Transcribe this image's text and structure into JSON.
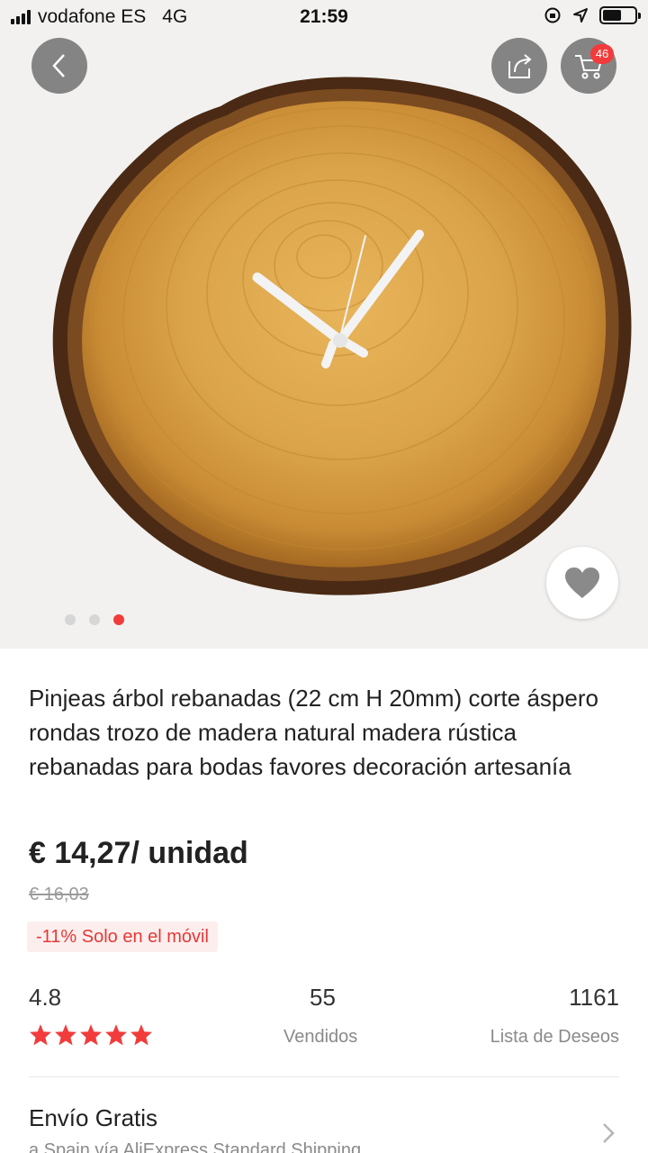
{
  "status_bar": {
    "carrier": "vodafone ES",
    "network": "4G",
    "time": "21:59"
  },
  "header": {
    "back_icon": "chevron-left-icon",
    "share_icon": "share-icon",
    "cart_icon": "cart-icon",
    "cart_count": "46"
  },
  "gallery": {
    "image_count": 3,
    "active_index": 2,
    "favorite_icon": "heart-icon"
  },
  "product": {
    "title": "Pinjeas árbol rebanadas (22 cm H 20mm) corte áspero rondas trozo de madera natural madera rústica rebanadas para bodas favores decoración artesanía",
    "price": "€ 14,27/ unidad",
    "old_price": "€ 16,03",
    "promo": "-11% Solo en el móvil"
  },
  "stats": {
    "rating": "4.8",
    "rating_stars": 5,
    "sold_value": "55",
    "sold_label": "Vendidos",
    "wishlist_value": "1161",
    "wishlist_label": "Lista de Deseos"
  },
  "shipping": {
    "title": "Envío Gratis",
    "subtitle": "a Spain vía AliExpress Standard Shipping"
  },
  "colors": {
    "accent": "#f23b3b",
    "star": "#f23b3b",
    "text": "#222222",
    "muted": "#8a8a8a"
  }
}
